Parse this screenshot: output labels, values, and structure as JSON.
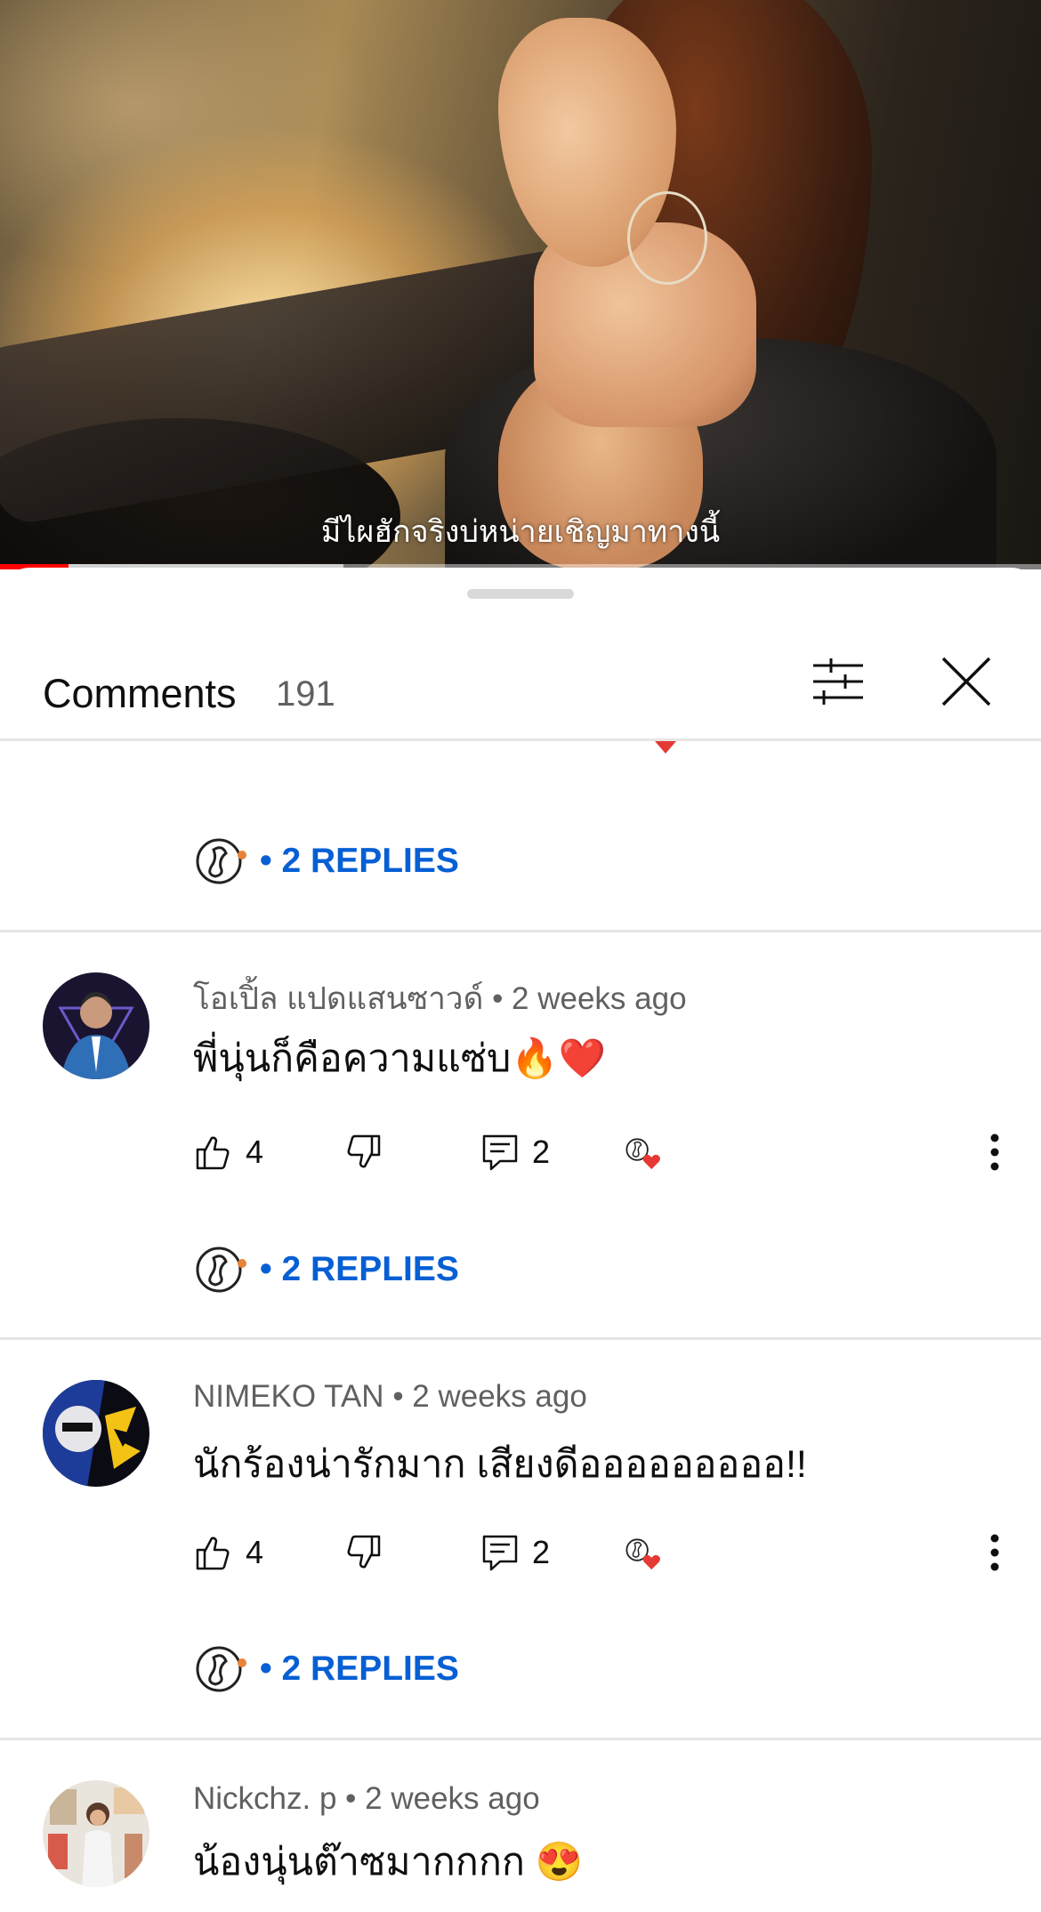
{
  "video": {
    "subtitle": "มีไผฮักจริงบ่หน่ายเชิญมาทางนี้",
    "progress_played_fraction": 0.066,
    "progress_buffered_fraction": 0.33,
    "accent_color": "#ff0000"
  },
  "sheet": {
    "title": "Comments",
    "count": "191",
    "filter_icon": "sliders-icon",
    "close_icon": "close-icon"
  },
  "replies_label": "• 2 REPLIES",
  "comments": [
    {
      "author": "โอเปิ้ล แปดแสนซาวด์",
      "time": "• 2 weeks ago",
      "text": "พี่นุ่นก็คือความแซ่บ🔥❤️",
      "likes": "4",
      "replies": "2"
    },
    {
      "author": "NIMEKO TAN",
      "time": "• 2 weeks ago",
      "text": "นักร้องน่ารักมาก เสียงดีอออออออออ!!",
      "likes": "4",
      "replies": "2"
    },
    {
      "author": "Nickchz. p",
      "time": "• 2 weeks ago",
      "text": "น้องนุ่นต๊าซมากกกก 😍"
    }
  ]
}
